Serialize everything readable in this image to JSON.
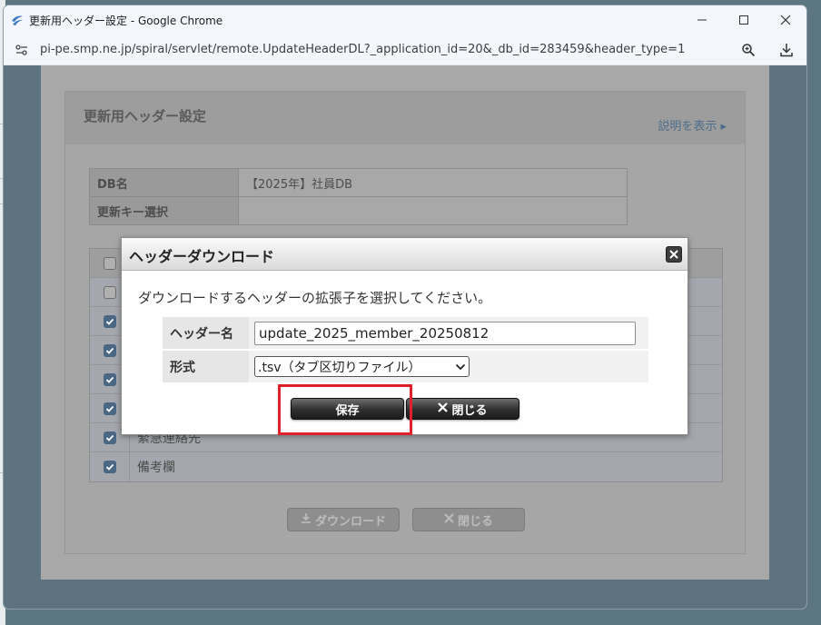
{
  "browser": {
    "title": "更新用ヘッダー設定 - Google Chrome",
    "url": "pi-pe.smp.ne.jp/spiral/servlet/remote.UpdateHeaderDL?_application_id=20&_db_id=283459&header_type=1"
  },
  "page": {
    "title": "更新用ヘッダー設定",
    "help_link": "説明を表示 ▸",
    "info_rows": [
      {
        "label": "DB名",
        "value": "【2025年】社員DB"
      },
      {
        "label": "更新キー選択",
        "value": ""
      }
    ],
    "fields": [
      {
        "label": "",
        "checked": false
      },
      {
        "label": "",
        "checked": false
      },
      {
        "label": "",
        "checked": true
      },
      {
        "label": "",
        "checked": true
      },
      {
        "label": "",
        "checked": true
      },
      {
        "label": "",
        "checked": true
      },
      {
        "label": "緊急連絡先",
        "checked": true
      },
      {
        "label": "備考欄",
        "checked": true
      }
    ],
    "download_button": "ダウンロード",
    "close_button": "閉じる"
  },
  "dialog": {
    "title": "ヘッダーダウンロード",
    "message": "ダウンロードするヘッダーの拡張子を選択してください。",
    "header_name_label": "ヘッダー名",
    "header_name_value": "update_2025_member_20250812",
    "format_label": "形式",
    "format_value": ".tsv（タブ区切りファイル）",
    "save_button": "保存",
    "close_button": "閉じる"
  },
  "colors": {
    "highlight": "#e0202a",
    "checkbox_checked": "#4a6783",
    "link": "#4e6d8a"
  }
}
